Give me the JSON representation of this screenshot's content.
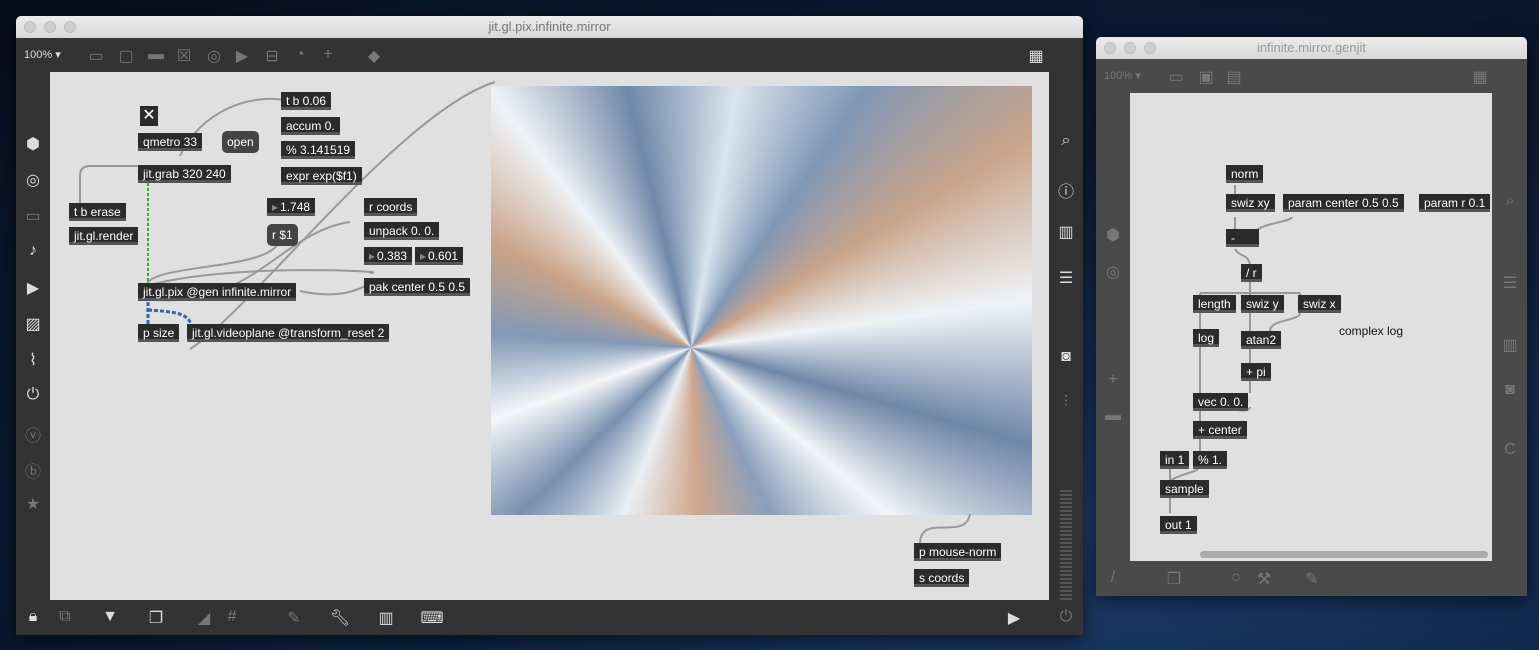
{
  "main_window": {
    "title": "jit.gl.pix.infinite.mirror",
    "zoom": "100%",
    "objects": [
      "qmetro 33",
      "jit.grab 320 240",
      "t b erase",
      "jit.gl.render",
      "t b 0.06",
      "accum 0.",
      "% 3.141519",
      "expr exp($f1)",
      "r coords",
      "unpack 0. 0.",
      "pak center 0.5 0.5",
      "jit.gl.pix @gen infinite.mirror",
      "p size",
      "jit.gl.videoplane @transform_reset 2",
      "p mouse-norm",
      "s coords"
    ],
    "messages": [
      "open",
      "r $1"
    ],
    "numbers": [
      "1.748",
      "0.383",
      "0.601"
    ],
    "toggle": "✕",
    "left_sidebar_icons": [
      "cube-icon",
      "target-icon",
      "media-icon",
      "music-note-icon",
      "video-icon",
      "image-icon",
      "paperclip-icon",
      "plug-icon",
      "vimeo-icon",
      "bandcamp-icon",
      "star-icon"
    ],
    "right_sidebar_icons": [
      "search-icon",
      "info-icon",
      "book-icon",
      "list-icon",
      "camera-icon",
      "mixer-icon"
    ]
  },
  "gen_window": {
    "title": "infinite.mirror.genjit",
    "zoom": "100%",
    "objects": [
      "norm",
      "swiz xy",
      "param center 0.5 0.5",
      "param r 0.1",
      "-",
      "/ r",
      "length",
      "swiz y",
      "swiz x",
      "log",
      "atan2",
      "+ pi",
      "vec 0. 0.",
      "+ center",
      "in 1",
      "% 1.",
      "sample",
      "out 1"
    ],
    "comment": "complex log"
  }
}
